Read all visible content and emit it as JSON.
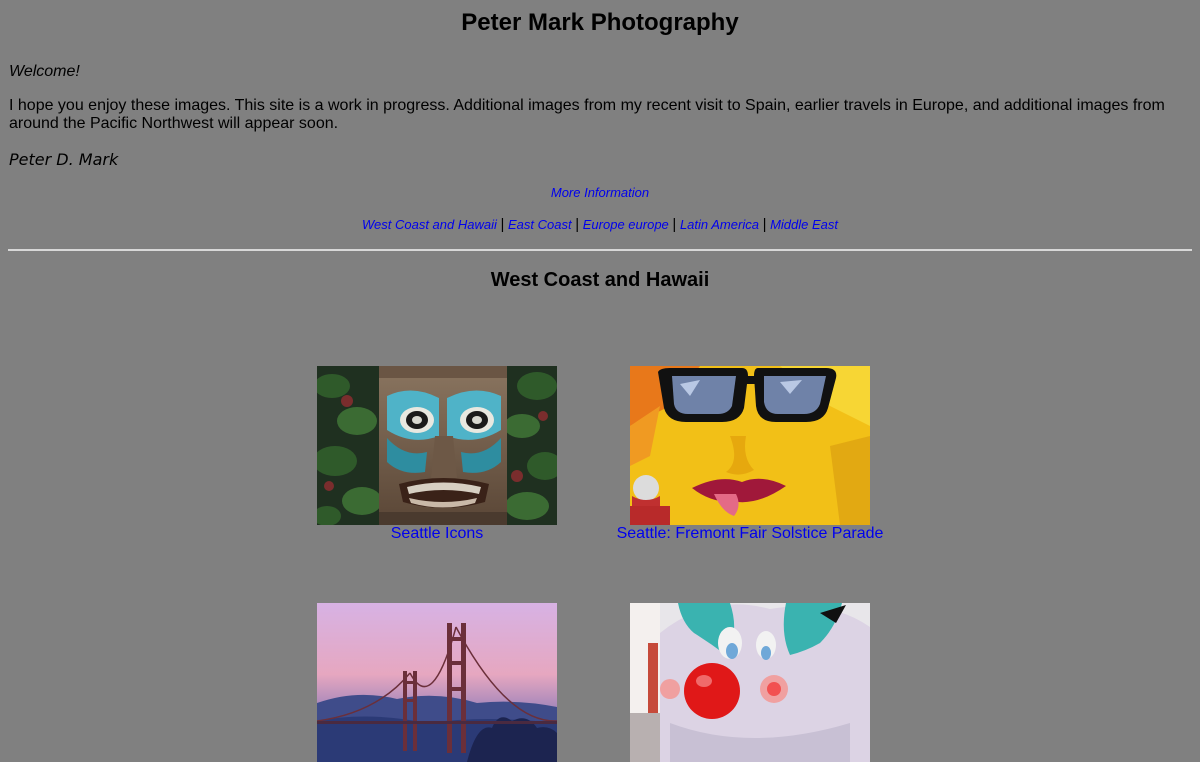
{
  "header": {
    "title": "Peter Mark Photography"
  },
  "intro": {
    "welcome": "Welcome!",
    "text": "I hope you enjoy these images. This site is a work in progress. Additional images from my recent visit to Spain, earlier travels in Europe, and additional images from around the Pacific Northwest will appear soon.",
    "signature": "Peter D. Mark"
  },
  "links": {
    "more_info": "More Information"
  },
  "nav": {
    "items": [
      {
        "label": "West Coast and Hawaii"
      },
      {
        "label": "East Coast"
      },
      {
        "label": "Europe europe"
      },
      {
        "label": "Latin America"
      },
      {
        "label": "Middle East"
      }
    ],
    "separator": "|"
  },
  "section": {
    "title": "West Coast and Hawaii"
  },
  "gallery": [
    {
      "caption": "Seattle Icons",
      "icon": "totem-pole-photo"
    },
    {
      "caption": "Seattle: Fremont Fair Solstice Parade",
      "icon": "sunglasses-face-photo"
    },
    {
      "caption": "",
      "icon": "golden-gate-bridge-photo"
    },
    {
      "caption": "",
      "icon": "clown-face-photo"
    }
  ],
  "colors": {
    "background": "#808080",
    "link": "#0000ee",
    "divider": "#d8d8d8"
  }
}
